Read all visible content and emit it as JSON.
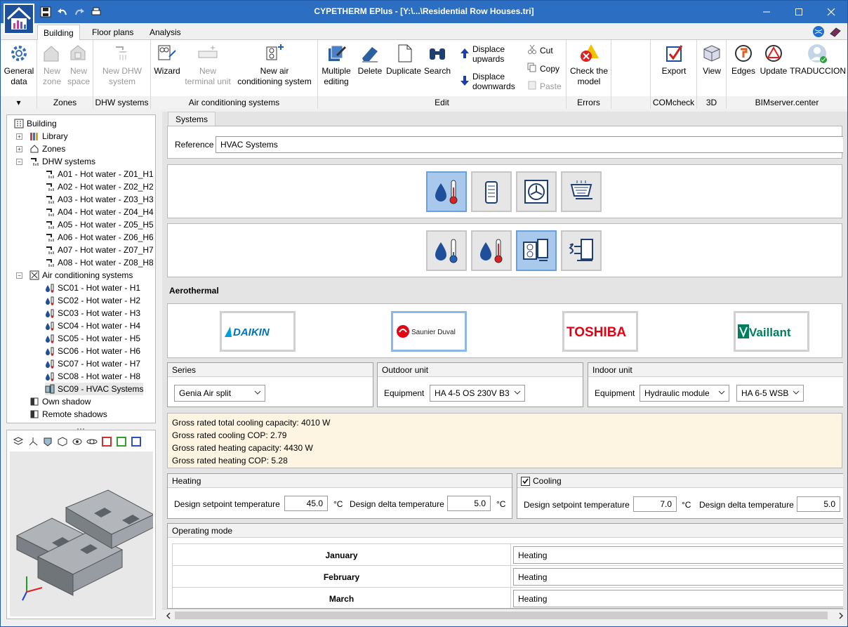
{
  "window": {
    "title": "CYPETHERM EPlus - [Y:\\...\\Residential Row Houses.tri]"
  },
  "tabs": [
    {
      "label": "Building"
    },
    {
      "label": "Floor plans"
    },
    {
      "label": "Analysis"
    }
  ],
  "ribbon": {
    "general": {
      "line1": "General",
      "line2": "data"
    },
    "zones": {
      "label": "Zones",
      "new_zone": [
        "New",
        "zone"
      ],
      "new_space": [
        "New",
        "space"
      ]
    },
    "dhw": {
      "label": "DHW systems",
      "new_dhw": [
        "New DHW",
        "system"
      ]
    },
    "ac": {
      "label": "Air conditioning systems",
      "wizard": "Wizard",
      "new_terminal": [
        "New",
        "terminal unit"
      ],
      "new_ac": [
        "New air",
        "conditioning system"
      ]
    },
    "edit": {
      "label": "Edit",
      "multiple": [
        "Multiple",
        "editing"
      ],
      "delete": "Delete",
      "duplicate": "Duplicate",
      "search": "Search",
      "up": [
        "Displace",
        "upwards"
      ],
      "down": [
        "Displace",
        "downwards"
      ],
      "cut": "Cut",
      "copy": "Copy",
      "paste": "Paste"
    },
    "errors": {
      "label": "Errors",
      "check": [
        "Check the",
        "model"
      ]
    },
    "comcheck": {
      "label": "COMcheck",
      "export": "Export"
    },
    "d3": {
      "label": "3D",
      "view": "View"
    },
    "bim": {
      "label": "BIMserver.center",
      "edges": "Edges",
      "update": "Update",
      "trad": "TRADUCCION"
    }
  },
  "tree": [
    {
      "label": "Building",
      "level": 0
    },
    {
      "label": "Library",
      "level": 1
    },
    {
      "label": "Zones",
      "level": 1
    },
    {
      "label": "DHW systems",
      "level": 1
    },
    {
      "label": "A01 - Hot water - Z01_H1",
      "level": 2
    },
    {
      "label": "A02 - Hot water - Z02_H2",
      "level": 2
    },
    {
      "label": "A03 - Hot water - Z03_H3",
      "level": 2
    },
    {
      "label": "A04 - Hot water - Z04_H4",
      "level": 2
    },
    {
      "label": "A05 - Hot water - Z05_H5",
      "level": 2
    },
    {
      "label": "A06 - Hot water - Z06_H6",
      "level": 2
    },
    {
      "label": "A07 - Hot water - Z07_H7",
      "level": 2
    },
    {
      "label": "A08 - Hot water - Z08_H8",
      "level": 2
    },
    {
      "label": "Air conditioning systems",
      "level": 1
    },
    {
      "label": "SC01 - Hot water - H1",
      "level": 2
    },
    {
      "label": "SC02 - Hot water - H2",
      "level": 2
    },
    {
      "label": "SC03 - Hot water - H3",
      "level": 2
    },
    {
      "label": "SC04 - Hot water - H4",
      "level": 2
    },
    {
      "label": "SC05 - Hot water - H5",
      "level": 2
    },
    {
      "label": "SC06 - Hot water - H6",
      "level": 2
    },
    {
      "label": "SC07 - Hot water - H7",
      "level": 2
    },
    {
      "label": "SC08 - Hot water - H8",
      "level": 2
    },
    {
      "label": "SC09 - HVAC Systems",
      "level": 2,
      "selected": true
    },
    {
      "label": "Own shadow",
      "level": 1
    },
    {
      "label": "Remote shadows",
      "level": 1
    }
  ],
  "main": {
    "tab": "Systems",
    "reference_label": "Reference",
    "reference_value": "HVAC Systems",
    "section_title": "Aerothermal",
    "brands": [
      "DAIKIN",
      "Saunier Duval",
      "TOSHIBA",
      "Vaillant"
    ],
    "series": {
      "title": "Series",
      "value": "Genia Air split"
    },
    "outdoor": {
      "title": "Outdoor unit",
      "label": "Equipment",
      "value": "HA 4-5 OS 230V B3"
    },
    "indoor": {
      "title": "Indoor unit",
      "label": "Equipment",
      "value1": "Hydraulic module",
      "value2": "HA 6-5 WSB"
    },
    "info": [
      "Gross rated total cooling capacity: 4010 W",
      "Gross rated cooling COP: 2.79",
      "Gross rated heating capacity: 4430 W",
      "Gross rated heating COP: 5.28"
    ],
    "heating": {
      "title": "Heating",
      "setpoint_label": "Design setpoint temperature",
      "setpoint": "45.0",
      "delta_label": "Design delta temperature",
      "delta": "5.0",
      "unit": "°C"
    },
    "cooling": {
      "title": "Cooling",
      "checked": true,
      "setpoint_label": "Design setpoint temperature",
      "setpoint": "7.0",
      "delta_label": "Design delta temperature",
      "delta": "5.0",
      "unit": "°C"
    },
    "operating": {
      "title": "Operating mode",
      "rows": [
        {
          "month": "January",
          "mode": "Heating"
        },
        {
          "month": "February",
          "mode": "Heating"
        },
        {
          "month": "March",
          "mode": "Heating"
        }
      ]
    }
  },
  "colors": {
    "titlebar": "#2b6ec2",
    "selected": "#a8c8ec",
    "info_bg": "#fdf5e2"
  }
}
